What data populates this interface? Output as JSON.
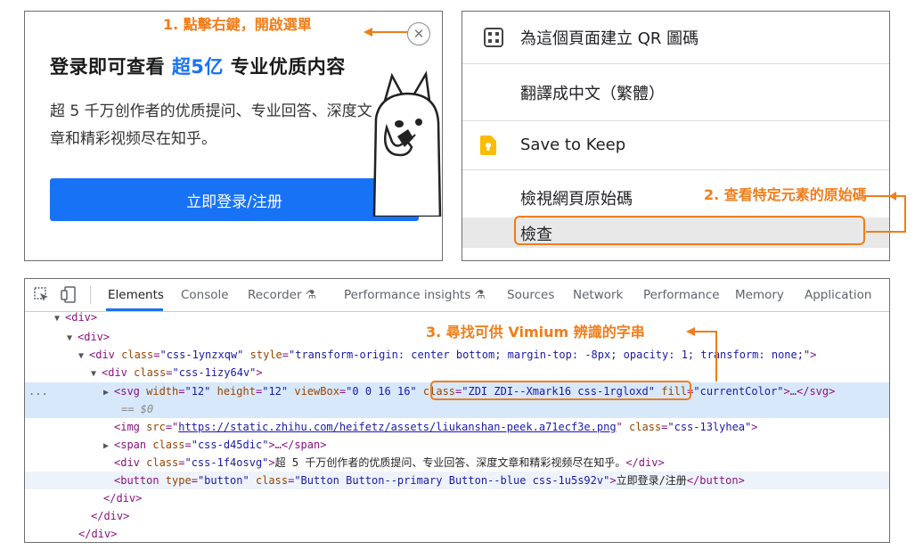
{
  "login_popup": {
    "heading_pre": "登录即可查看 ",
    "heading_highlight": "超5亿",
    "heading_post": " 专业优质内容",
    "description": "超 5 千万创作者的优质提问、专业回答、深度文章和精彩视频尽在知乎。",
    "login_button": "立即登录/注册",
    "close_symbol": "✕"
  },
  "context_menu": {
    "items": [
      {
        "label": "為這個頁面建立 QR 圖碼",
        "icon": "qr-code-icon"
      },
      {
        "label": "翻譯成中文（繁體）",
        "icon": ""
      },
      {
        "label": "Save to Keep",
        "icon": "keep-icon"
      },
      {
        "label": "檢視網頁原始碼",
        "icon": ""
      },
      {
        "label": "檢查",
        "icon": ""
      }
    ]
  },
  "annotations": {
    "step1": "1. 點擊右鍵，開啟選單",
    "step2": "2. 查看特定元素的原始碼",
    "step3": "3. 尋找可供 Vimium 辨識的字串",
    "accent_color": "#f07d1a"
  },
  "devtools": {
    "tabs": [
      "Elements",
      "Console",
      "Recorder",
      "Performance insights",
      "Sources",
      "Network",
      "Performance",
      "Memory",
      "Application"
    ],
    "active_tab": "Elements",
    "ellipsis": "...",
    "lines": {
      "l1": "<div>",
      "l2": "<div>",
      "l3_tag_open": "<div ",
      "l3_attr1": "class",
      "l3_val1": "\"css-1ynzxqw\"",
      "l3_attr2": "style",
      "l3_val2": "\"transform-origin: center bottom; margin-top: -8px; opacity: 1; transform: none;\"",
      "l4_tag_open": "<div ",
      "l4_attr": "class",
      "l4_val": "\"css-1izy64v\"",
      "l5_tag": "<svg ",
      "l5_a1": "width",
      "l5_v1": "\"12\"",
      "l5_a2": "height",
      "l5_v2": "\"12\"",
      "l5_a3": "viewBox",
      "l5_v3": "\"0 0 16 16\"",
      "l5_a4": "class",
      "l5_v4": "\"ZDI ZDI--Xmark16 css-1rgloxd\"",
      "l5_a5": "fill",
      "l5_v5": "\"currentColor\"",
      "l5_rest": "…</svg>",
      "l6": "== $0",
      "l7_tag": "<img ",
      "l7_a1": "src",
      "l7_v1": "https://static.zhihu.com/heifetz/assets/liukanshan-peek.a71ecf3e.png",
      "l7_a2": "class",
      "l7_v2": "\"css-13lyhea\"",
      "l8_tag": "<span ",
      "l8_a": "class",
      "l8_v": "\"css-d45dic\"",
      "l8_rest": "…</span>",
      "l9_tag": "<div ",
      "l9_a": "class",
      "l9_v": "\"css-1f4osvg\"",
      "l9_text": "超 5 千万创作者的优质提问、专业回答、深度文章和精彩视频尽在知乎。",
      "l10_tag": "<button ",
      "l10_a1": "type",
      "l10_v1": "\"button\"",
      "l10_a2": "class",
      "l10_v2": "\"Button Button--primary Button--blue css-1u5s92v\"",
      "l10_text": "立即登录/注册",
      "close_div": "</div>",
      "close_button": "</button>"
    }
  }
}
